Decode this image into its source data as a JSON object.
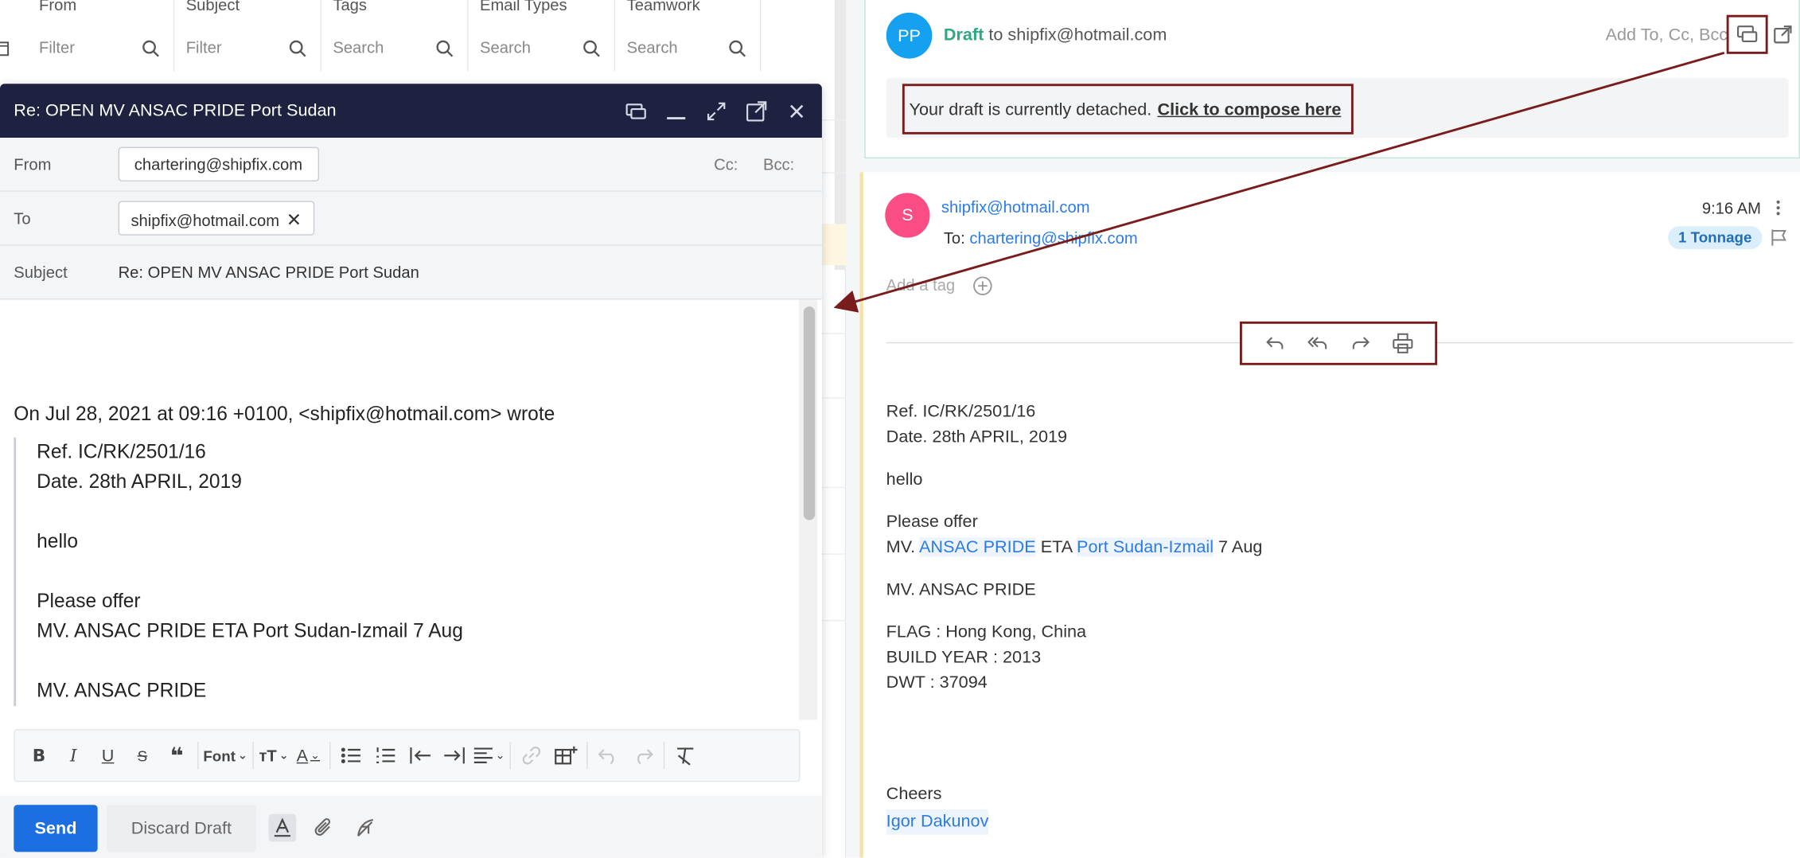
{
  "filters": [
    {
      "title": "From",
      "placeholder": "Filter"
    },
    {
      "title": "Subject",
      "placeholder": "Filter"
    },
    {
      "title": "Tags",
      "placeholder": "Search"
    },
    {
      "title": "Email Types",
      "placeholder": "Search"
    },
    {
      "title": "Teamwork",
      "placeholder": "Search"
    }
  ],
  "compose": {
    "title": "Re: OPEN MV ANSAC PRIDE Port Sudan",
    "from_label": "From",
    "from_value": "chartering@shipfix.com",
    "cc_label": "Cc:",
    "bcc_label": "Bcc:",
    "to_label": "To",
    "to_value": "shipfix@hotmail.com",
    "to_remove": "✕",
    "subject_label": "Subject",
    "subject_value": "Re: OPEN MV ANSAC PRIDE Port Sudan",
    "quote_intro": "On Jul 28, 2021 at 09:16 +0100, <shipfix@hotmail.com> wrote",
    "quote_lines": {
      "l1": "Ref. IC/RK/2501/16",
      "l2": "Date. 28th APRIL, 2019",
      "l3": "hello",
      "l4": "Please offer",
      "l5": "MV. ANSAC PRIDE ETA Port Sudan-Izmail 7 Aug",
      "l6": "MV. ANSAC PRIDE"
    },
    "toolbar": {
      "bold": "B",
      "italic": "I",
      "underline": "U",
      "strike": "S",
      "quote": "❝",
      "font": "Font",
      "size": "тT",
      "color": "A"
    },
    "send_label": "Send",
    "discard_label": "Discard Draft"
  },
  "draft": {
    "avatar": "PP",
    "label": "Draft",
    "to_text": " to shipfix@hotmail.com",
    "add_to": "Add To, Cc, Bcc",
    "detached_text": "Your draft is currently detached.",
    "compose_here": "Click to compose here"
  },
  "message": {
    "avatar": "S",
    "from": "shipfix@hotmail.com",
    "to_label": "To: ",
    "to": "chartering@shipfix.com",
    "time": "9:16 AM",
    "badge": "1 Tonnage",
    "add_tag": "Add a tag",
    "body": {
      "ref": "Ref. IC/RK/2501/16",
      "date": "Date. 28th APRIL, 2019",
      "hello": "hello",
      "offer": "Please offer",
      "mv_prefix": "MV. ",
      "vessel": "ANSAC PRIDE",
      "eta": " ETA ",
      "route": "Port Sudan-Izmail",
      "eta_date": " 7 Aug",
      "vessel_line": "MV. ANSAC PRIDE",
      "flag": "FLAG : Hong Kong, China",
      "build": "BUILD YEAR : 2013",
      "dwt": "DWT : 37094",
      "cheers": "Cheers",
      "signature": "Igor Dakunov"
    }
  },
  "colors": {
    "compose_header": "#1e2240",
    "send": "#1b6fe0",
    "draft_green": "#2aab7e",
    "link_blue": "#2c7be5",
    "annotation": "#7a1c1c"
  }
}
